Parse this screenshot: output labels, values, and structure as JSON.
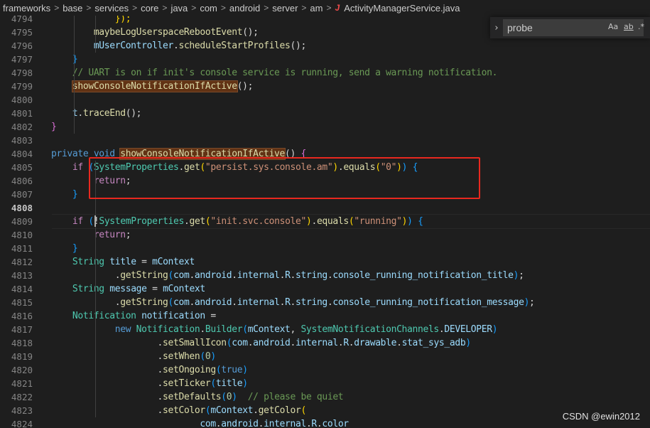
{
  "breadcrumb": {
    "items": [
      "frameworks",
      "base",
      "services",
      "core",
      "java",
      "com",
      "android",
      "server",
      "am"
    ],
    "file": "ActivityManagerService.java",
    "file_icon": "J"
  },
  "find": {
    "toggle_icon": "chevron-right-icon",
    "query": "probe",
    "match_case": "Aa",
    "whole_word": "ab",
    "regex": ".*"
  },
  "colors": {
    "keyword": "#569cd6",
    "control": "#c586c0",
    "function": "#dcdcaa",
    "type": "#4ec9b0",
    "variable": "#9cdcfe",
    "string": "#ce9178",
    "comment": "#6a9955",
    "highlight_box": "#e8281f"
  },
  "lines": [
    {
      "n": "4794",
      "tokens": [
        [
          "            ",
          "pl"
        ],
        [
          "});",
          "br3"
        ]
      ]
    },
    {
      "n": "4795",
      "tokens": [
        [
          "        ",
          "pl"
        ],
        [
          "maybeLogUserspaceRebootEvent",
          "fn"
        ],
        [
          "();",
          "pl"
        ]
      ]
    },
    {
      "n": "4796",
      "tokens": [
        [
          "        ",
          "pl"
        ],
        [
          "mUserController",
          "var"
        ],
        [
          ".",
          "pl"
        ],
        [
          "scheduleStartProfiles",
          "fn"
        ],
        [
          "();",
          "pl"
        ]
      ]
    },
    {
      "n": "4797",
      "tokens": [
        [
          "    ",
          "pl"
        ],
        [
          "}",
          "br2"
        ]
      ]
    },
    {
      "n": "4798",
      "tokens": [
        [
          "    ",
          "pl"
        ],
        [
          "// UART is on if init's console service is running, send a warning notification.",
          "cm"
        ]
      ]
    },
    {
      "n": "4799",
      "tokens": [
        [
          "    ",
          "pl"
        ],
        [
          "showConsoleNotificationIfActive",
          "fn hl"
        ],
        [
          "();",
          "pl"
        ]
      ]
    },
    {
      "n": "4800",
      "tokens": []
    },
    {
      "n": "4801",
      "tokens": [
        [
          "    ",
          "pl"
        ],
        [
          "t",
          "var"
        ],
        [
          ".",
          "pl"
        ],
        [
          "traceEnd",
          "fn"
        ],
        [
          "();",
          "pl"
        ]
      ]
    },
    {
      "n": "4802",
      "tokens": [
        [
          "}",
          "br1"
        ]
      ]
    },
    {
      "n": "4803",
      "tokens": []
    },
    {
      "n": "4804",
      "tokens": [
        [
          "private",
          "kw"
        ],
        [
          " ",
          "pl"
        ],
        [
          "void",
          "kw"
        ],
        [
          " ",
          "pl"
        ],
        [
          "showConsoleNotificationIfActive",
          "fn hl"
        ],
        [
          "() ",
          "pl"
        ],
        [
          "{",
          "br1"
        ]
      ]
    },
    {
      "n": "4805",
      "tokens": [
        [
          "    ",
          "pl"
        ],
        [
          "if",
          "ctl"
        ],
        [
          " ",
          "pl"
        ],
        [
          "(",
          "br2"
        ],
        [
          "SystemProperties",
          "ty"
        ],
        [
          ".",
          "pl"
        ],
        [
          "get",
          "fn"
        ],
        [
          "(",
          "br3"
        ],
        [
          "\"persist.sys.console.am\"",
          "str"
        ],
        [
          ")",
          "br3"
        ],
        [
          ".",
          "pl"
        ],
        [
          "equals",
          "fn"
        ],
        [
          "(",
          "br3"
        ],
        [
          "\"0\"",
          "str"
        ],
        [
          ")",
          "br3"
        ],
        [
          ")",
          "br2"
        ],
        [
          " ",
          "pl"
        ],
        [
          "{",
          "br2"
        ]
      ]
    },
    {
      "n": "4806",
      "tokens": [
        [
          "        ",
          "pl"
        ],
        [
          "return",
          "ctl"
        ],
        [
          ";",
          "pl"
        ]
      ]
    },
    {
      "n": "4807",
      "tokens": [
        [
          "    ",
          "pl"
        ],
        [
          "}",
          "br2"
        ]
      ]
    },
    {
      "n": "4808",
      "tokens": [],
      "current": true
    },
    {
      "n": "4809",
      "tokens": [
        [
          "    ",
          "pl"
        ],
        [
          "if",
          "ctl"
        ],
        [
          " ",
          "pl"
        ],
        [
          "(",
          "br2"
        ],
        [
          "!",
          "pl"
        ],
        [
          "SystemProperties",
          "ty"
        ],
        [
          ".",
          "pl"
        ],
        [
          "get",
          "fn"
        ],
        [
          "(",
          "br3"
        ],
        [
          "\"init.svc.console\"",
          "str"
        ],
        [
          ")",
          "br3"
        ],
        [
          ".",
          "pl"
        ],
        [
          "equals",
          "fn"
        ],
        [
          "(",
          "br3"
        ],
        [
          "\"running\"",
          "str"
        ],
        [
          ")",
          "br3"
        ],
        [
          ")",
          "br2"
        ],
        [
          " ",
          "pl"
        ],
        [
          "{",
          "br2"
        ]
      ]
    },
    {
      "n": "4810",
      "tokens": [
        [
          "        ",
          "pl"
        ],
        [
          "return",
          "ctl"
        ],
        [
          ";",
          "pl"
        ]
      ]
    },
    {
      "n": "4811",
      "tokens": [
        [
          "    ",
          "pl"
        ],
        [
          "}",
          "br2"
        ]
      ]
    },
    {
      "n": "4812",
      "tokens": [
        [
          "    ",
          "pl"
        ],
        [
          "String",
          "ty"
        ],
        [
          " ",
          "pl"
        ],
        [
          "title",
          "var"
        ],
        [
          " = ",
          "pl"
        ],
        [
          "mContext",
          "var"
        ]
      ]
    },
    {
      "n": "4813",
      "tokens": [
        [
          "            ",
          "pl"
        ],
        [
          ".",
          "pl"
        ],
        [
          "getString",
          "fn"
        ],
        [
          "(",
          "br2"
        ],
        [
          "com",
          "var"
        ],
        [
          ".",
          "pl"
        ],
        [
          "android",
          "var"
        ],
        [
          ".",
          "pl"
        ],
        [
          "internal",
          "var"
        ],
        [
          ".",
          "pl"
        ],
        [
          "R",
          "var"
        ],
        [
          ".",
          "pl"
        ],
        [
          "string",
          "var"
        ],
        [
          ".",
          "pl"
        ],
        [
          "console_running_notification_title",
          "var"
        ],
        [
          ")",
          "br2"
        ],
        [
          ";",
          "pl"
        ]
      ]
    },
    {
      "n": "4814",
      "tokens": [
        [
          "    ",
          "pl"
        ],
        [
          "String",
          "ty"
        ],
        [
          " ",
          "pl"
        ],
        [
          "message",
          "var"
        ],
        [
          " = ",
          "pl"
        ],
        [
          "mContext",
          "var"
        ]
      ]
    },
    {
      "n": "4815",
      "tokens": [
        [
          "            ",
          "pl"
        ],
        [
          ".",
          "pl"
        ],
        [
          "getString",
          "fn"
        ],
        [
          "(",
          "br2"
        ],
        [
          "com",
          "var"
        ],
        [
          ".",
          "pl"
        ],
        [
          "android",
          "var"
        ],
        [
          ".",
          "pl"
        ],
        [
          "internal",
          "var"
        ],
        [
          ".",
          "pl"
        ],
        [
          "R",
          "var"
        ],
        [
          ".",
          "pl"
        ],
        [
          "string",
          "var"
        ],
        [
          ".",
          "pl"
        ],
        [
          "console_running_notification_message",
          "var"
        ],
        [
          ")",
          "br2"
        ],
        [
          ";",
          "pl"
        ]
      ]
    },
    {
      "n": "4816",
      "tokens": [
        [
          "    ",
          "pl"
        ],
        [
          "Notification",
          "ty"
        ],
        [
          " ",
          "pl"
        ],
        [
          "notification",
          "var"
        ],
        [
          " =",
          "pl"
        ]
      ]
    },
    {
      "n": "4817",
      "tokens": [
        [
          "            ",
          "pl"
        ],
        [
          "new",
          "kw"
        ],
        [
          " ",
          "pl"
        ],
        [
          "Notification",
          "ty"
        ],
        [
          ".",
          "pl"
        ],
        [
          "Builder",
          "ty"
        ],
        [
          "(",
          "br2"
        ],
        [
          "mContext",
          "var"
        ],
        [
          ", ",
          "pl"
        ],
        [
          "SystemNotificationChannels",
          "ty"
        ],
        [
          ".",
          "pl"
        ],
        [
          "DEVELOPER",
          "var"
        ],
        [
          ")",
          "br2"
        ]
      ]
    },
    {
      "n": "4818",
      "tokens": [
        [
          "                    ",
          "pl"
        ],
        [
          ".",
          "pl"
        ],
        [
          "setSmallIcon",
          "fn"
        ],
        [
          "(",
          "br2"
        ],
        [
          "com",
          "var"
        ],
        [
          ".",
          "pl"
        ],
        [
          "android",
          "var"
        ],
        [
          ".",
          "pl"
        ],
        [
          "internal",
          "var"
        ],
        [
          ".",
          "pl"
        ],
        [
          "R",
          "var"
        ],
        [
          ".",
          "pl"
        ],
        [
          "drawable",
          "var"
        ],
        [
          ".",
          "pl"
        ],
        [
          "stat_sys_adb",
          "var"
        ],
        [
          ")",
          "br2"
        ]
      ]
    },
    {
      "n": "4819",
      "tokens": [
        [
          "                    ",
          "pl"
        ],
        [
          ".",
          "pl"
        ],
        [
          "setWhen",
          "fn"
        ],
        [
          "(",
          "br2"
        ],
        [
          "0",
          "num-lit"
        ],
        [
          ")",
          "br2"
        ]
      ]
    },
    {
      "n": "4820",
      "tokens": [
        [
          "                    ",
          "pl"
        ],
        [
          ".",
          "pl"
        ],
        [
          "setOngoing",
          "fn"
        ],
        [
          "(",
          "br2"
        ],
        [
          "true",
          "kw"
        ],
        [
          ")",
          "br2"
        ]
      ]
    },
    {
      "n": "4821",
      "tokens": [
        [
          "                    ",
          "pl"
        ],
        [
          ".",
          "pl"
        ],
        [
          "setTicker",
          "fn"
        ],
        [
          "(",
          "br2"
        ],
        [
          "title",
          "var"
        ],
        [
          ")",
          "br2"
        ]
      ]
    },
    {
      "n": "4822",
      "tokens": [
        [
          "                    ",
          "pl"
        ],
        [
          ".",
          "pl"
        ],
        [
          "setDefaults",
          "fn"
        ],
        [
          "(",
          "br2"
        ],
        [
          "0",
          "num-lit"
        ],
        [
          ")",
          "br2"
        ],
        [
          "  ",
          "pl"
        ],
        [
          "// please be quiet",
          "cm"
        ]
      ]
    },
    {
      "n": "4823",
      "tokens": [
        [
          "                    ",
          "pl"
        ],
        [
          ".",
          "pl"
        ],
        [
          "setColor",
          "fn"
        ],
        [
          "(",
          "br2"
        ],
        [
          "mContext",
          "var"
        ],
        [
          ".",
          "pl"
        ],
        [
          "getColor",
          "fn"
        ],
        [
          "(",
          "br3"
        ]
      ]
    },
    {
      "n": "4824",
      "tokens": [
        [
          "                            ",
          "pl"
        ],
        [
          "com",
          "var"
        ],
        [
          ".",
          "pl"
        ],
        [
          "android",
          "var"
        ],
        [
          ".",
          "pl"
        ],
        [
          "internal",
          "var"
        ],
        [
          ".",
          "pl"
        ],
        [
          "R",
          "var"
        ],
        [
          ".",
          "pl"
        ],
        [
          "color",
          "var"
        ]
      ]
    }
  ],
  "watermark": "CSDN @ewin2012"
}
